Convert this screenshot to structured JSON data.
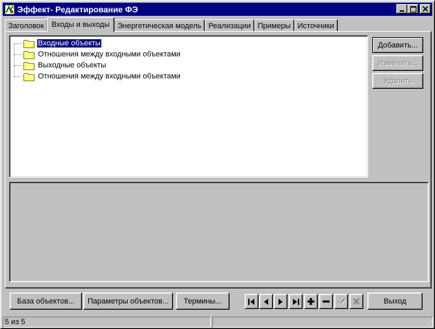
{
  "window": {
    "title": "Эффект- Редактирование ФЭ"
  },
  "tabs": [
    {
      "label": "Заголовок",
      "active": false
    },
    {
      "label": "Входы и выходы",
      "active": true
    },
    {
      "label": "Энергетическая модель",
      "active": false
    },
    {
      "label": "Реализации",
      "active": false
    },
    {
      "label": "Примеры",
      "active": false
    },
    {
      "label": "Источники",
      "active": false
    }
  ],
  "tree": {
    "items": [
      {
        "label": "Входные объекты",
        "selected": true
      },
      {
        "label": "Отношения между входными объектами",
        "selected": false
      },
      {
        "label": "Выходные объекты",
        "selected": false
      },
      {
        "label": "Отношения между входными объектами",
        "selected": false
      }
    ]
  },
  "side_buttons": {
    "add": "Добавить...",
    "edit": "Изменить...",
    "delete": "Удалить"
  },
  "bottom_buttons": {
    "objects_db": "База объектов...",
    "object_params": "Параметры объектов...",
    "terms": "Термины...",
    "exit": "Выход"
  },
  "navigator": {
    "icons": [
      "first-record-icon",
      "prior-record-icon",
      "next-record-icon",
      "last-record-icon",
      "insert-record-icon",
      "delete-record-icon",
      "post-record-icon",
      "cancel-record-icon"
    ]
  },
  "status": {
    "record_position": "5 из 5",
    "second_pane": ""
  },
  "colors": {
    "titlebar": "#000080",
    "face": "#c0c0c0",
    "selection": "#000080",
    "folder": "#ffff80"
  }
}
